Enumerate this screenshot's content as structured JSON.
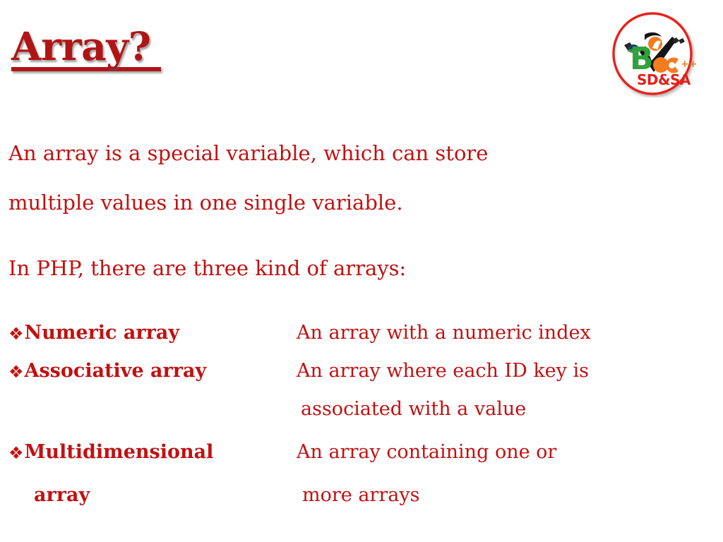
{
  "slide": {
    "background_color": "#FFFFFF",
    "title": "Array?",
    "title_color": "#B11414",
    "body_color": "#C11111",
    "intro_line_1": "An array is a special variable, which can store",
    "intro_line_2": "multiple values in one single variable.",
    "kinds_lead": "In PHP, there are three kind of arrays:",
    "bullet_glyph": "❖"
  },
  "logo": {
    "name": "bvoc-sdsa-logo",
    "ring_color": "#E8231C",
    "letter_b": "B",
    "letter_o": "O",
    "letter_c": "C",
    "plusplus": "++",
    "subtitle": "SD&SA",
    "subtitle_color": "#E1201A",
    "green": "#2FA23C",
    "orange": "#F47C20",
    "black": "#111111"
  },
  "definitions": [
    {
      "term": "Numeric array",
      "description": "An array with a numeric index",
      "description_cont": "",
      "term_cont": ""
    },
    {
      "term": "Associative array",
      "description": "An array where each ID key is",
      "description_cont": "associated with a value",
      "term_cont": ""
    },
    {
      "term": "Multidimensional",
      "description": "An array containing one or",
      "description_cont": "more arrays",
      "term_cont": "array"
    }
  ]
}
